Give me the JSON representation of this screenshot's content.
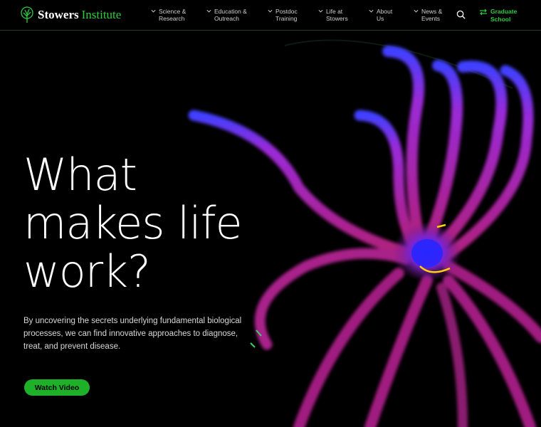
{
  "header": {
    "logo_strong": "Stowers",
    "logo_light": "Institute",
    "nav": [
      {
        "label": "Science &\nResearch"
      },
      {
        "label": "Education &\nOutreach"
      },
      {
        "label": "Postdoc\nTraining"
      },
      {
        "label": "Life at\nStowers"
      },
      {
        "label": "About\nUs"
      },
      {
        "label": "News &\nEvents"
      }
    ],
    "graduate_label": "Graduate\nSchool",
    "icons": {
      "search": "search-icon",
      "chevron": "chevron-down-icon",
      "graduate": "transfer-arrows-icon",
      "logo": "tree-logo-icon"
    }
  },
  "hero": {
    "title": "What\nmakes life\nwork?",
    "description": "By uncovering the secrets underlying fundamental biological processes, we can find innovative approaches to diagnose, treat, and prevent disease.",
    "button_label": "Watch Video"
  },
  "colors": {
    "accent": "#2ecc40",
    "button": "#1fb02a",
    "background": "#000000"
  }
}
